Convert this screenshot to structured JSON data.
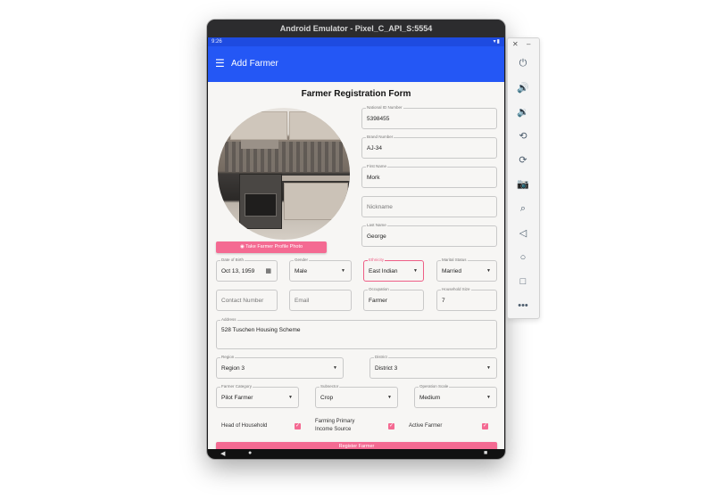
{
  "window": {
    "title": "Android Emulator - Pixel_C_API_S:5554"
  },
  "statusbar": {
    "time": "9:26",
    "icons": "▾▮"
  },
  "appbar": {
    "title": "Add Farmer",
    "menu_icon": "menu-icon"
  },
  "form": {
    "title": "Farmer Registration Form",
    "photo_button": "Take Farmer Profile Photo",
    "national_id": {
      "label": "National ID Number",
      "value": "5398455"
    },
    "brand_number": {
      "label": "Brand Number",
      "value": "AJ-34"
    },
    "first_name": {
      "label": "First Name",
      "value": "Mork"
    },
    "nickname": {
      "placeholder": "Nickname"
    },
    "last_name": {
      "label": "Last Name",
      "value": "George"
    },
    "dob": {
      "label": "Date of Birth",
      "value": "Oct 13, 1959"
    },
    "gender": {
      "label": "Gender",
      "value": "Male"
    },
    "ethnicity": {
      "label": "Ethnicity",
      "value": "East Indian"
    },
    "marital": {
      "label": "Marital Status",
      "value": "Married"
    },
    "contact": {
      "placeholder": "Contact Number"
    },
    "email": {
      "placeholder": "Email"
    },
    "occupation": {
      "label": "Occupation",
      "value": "Farmer"
    },
    "household": {
      "label": "Household Size",
      "value": "7"
    },
    "address": {
      "label": "Address",
      "value": "528 Tuschen Housing Scheme"
    },
    "region": {
      "label": "Region",
      "value": "Region 3"
    },
    "district": {
      "label": "District",
      "value": "District 3"
    },
    "category": {
      "label": "Farmer Category",
      "value": "Pilot Farmer"
    },
    "subsector": {
      "label": "Subsector",
      "value": "Crop"
    },
    "scale": {
      "label": "Operation Scale",
      "value": "Medium"
    },
    "head_household": "Head of Household",
    "primary_income": "Farming Primary Income Source",
    "active_farmer": "Active Farmer",
    "register_button": "Register Farmer"
  },
  "sidebar": {
    "close": "✕",
    "minimize": "–",
    "buttons": [
      "power-icon",
      "volume-up-icon",
      "volume-down-icon",
      "rotate-left-icon",
      "rotate-right-icon",
      "camera-icon",
      "zoom-icon",
      "back-icon",
      "home-icon",
      "overview-icon",
      "more-icon"
    ]
  },
  "colors": {
    "appbar": "#2457f5",
    "accent": "#f46a92",
    "error": "#ee5e86"
  }
}
